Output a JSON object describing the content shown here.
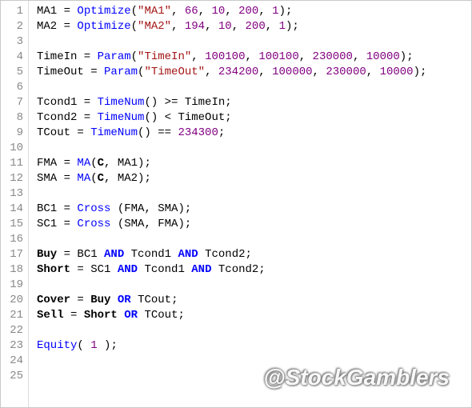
{
  "watermark": "@StockGamblers",
  "lines": [
    {
      "n": "1",
      "tokens": [
        {
          "t": "MA1 = "
        },
        {
          "t": "Optimize",
          "c": "fn"
        },
        {
          "t": "("
        },
        {
          "t": "\"MA1\"",
          "c": "str"
        },
        {
          "t": ", "
        },
        {
          "t": "66",
          "c": "num"
        },
        {
          "t": ", "
        },
        {
          "t": "10",
          "c": "num"
        },
        {
          "t": ", "
        },
        {
          "t": "200",
          "c": "num"
        },
        {
          "t": ", "
        },
        {
          "t": "1",
          "c": "num"
        },
        {
          "t": ");"
        }
      ]
    },
    {
      "n": "2",
      "tokens": [
        {
          "t": "MA2 = "
        },
        {
          "t": "Optimize",
          "c": "fn"
        },
        {
          "t": "("
        },
        {
          "t": "\"MA2\"",
          "c": "str"
        },
        {
          "t": ", "
        },
        {
          "t": "194",
          "c": "num"
        },
        {
          "t": ", "
        },
        {
          "t": "10",
          "c": "num"
        },
        {
          "t": ", "
        },
        {
          "t": "200",
          "c": "num"
        },
        {
          "t": ", "
        },
        {
          "t": "1",
          "c": "num"
        },
        {
          "t": ");"
        }
      ]
    },
    {
      "n": "3",
      "tokens": []
    },
    {
      "n": "4",
      "tokens": [
        {
          "t": "TimeIn = "
        },
        {
          "t": "Param",
          "c": "fn"
        },
        {
          "t": "("
        },
        {
          "t": "\"TimeIn\"",
          "c": "str"
        },
        {
          "t": ", "
        },
        {
          "t": "100100",
          "c": "num"
        },
        {
          "t": ", "
        },
        {
          "t": "100100",
          "c": "num"
        },
        {
          "t": ", "
        },
        {
          "t": "230000",
          "c": "num"
        },
        {
          "t": ", "
        },
        {
          "t": "10000",
          "c": "num"
        },
        {
          "t": ");"
        }
      ]
    },
    {
      "n": "5",
      "tokens": [
        {
          "t": "TimeOut = "
        },
        {
          "t": "Param",
          "c": "fn"
        },
        {
          "t": "("
        },
        {
          "t": "\"TimeOut\"",
          "c": "str"
        },
        {
          "t": ", "
        },
        {
          "t": "234200",
          "c": "num"
        },
        {
          "t": ", "
        },
        {
          "t": "100000",
          "c": "num"
        },
        {
          "t": ", "
        },
        {
          "t": "230000",
          "c": "num"
        },
        {
          "t": ", "
        },
        {
          "t": "10000",
          "c": "num"
        },
        {
          "t": ");"
        }
      ]
    },
    {
      "n": "6",
      "tokens": []
    },
    {
      "n": "7",
      "tokens": [
        {
          "t": "Tcond1 = "
        },
        {
          "t": "TimeNum",
          "c": "fn"
        },
        {
          "t": "() >= TimeIn;"
        }
      ]
    },
    {
      "n": "8",
      "tokens": [
        {
          "t": "Tcond2 = "
        },
        {
          "t": "TimeNum",
          "c": "fn"
        },
        {
          "t": "() < TimeOut;"
        }
      ]
    },
    {
      "n": "9",
      "tokens": [
        {
          "t": "TCout = "
        },
        {
          "t": "TimeNum",
          "c": "fn"
        },
        {
          "t": "() == "
        },
        {
          "t": "234300",
          "c": "num"
        },
        {
          "t": ";"
        }
      ]
    },
    {
      "n": "10",
      "tokens": []
    },
    {
      "n": "11",
      "tokens": [
        {
          "t": "FMA = "
        },
        {
          "t": "MA",
          "c": "fn"
        },
        {
          "t": "("
        },
        {
          "t": "C",
          "c": "bld"
        },
        {
          "t": ", MA1);"
        }
      ]
    },
    {
      "n": "12",
      "tokens": [
        {
          "t": "SMA = "
        },
        {
          "t": "MA",
          "c": "fn"
        },
        {
          "t": "("
        },
        {
          "t": "C",
          "c": "bld"
        },
        {
          "t": ", MA2);"
        }
      ]
    },
    {
      "n": "13",
      "tokens": []
    },
    {
      "n": "14",
      "tokens": [
        {
          "t": "BC1 = "
        },
        {
          "t": "Cross",
          "c": "fn"
        },
        {
          "t": " (FMA, SMA);"
        }
      ]
    },
    {
      "n": "15",
      "tokens": [
        {
          "t": "SC1 = "
        },
        {
          "t": "Cross",
          "c": "fn"
        },
        {
          "t": " (SMA, FMA);"
        }
      ]
    },
    {
      "n": "16",
      "tokens": []
    },
    {
      "n": "17",
      "tokens": [
        {
          "t": "Buy",
          "c": "bld"
        },
        {
          "t": " = BC1 "
        },
        {
          "t": "AND",
          "c": "kw"
        },
        {
          "t": " Tcond1 "
        },
        {
          "t": "AND",
          "c": "kw"
        },
        {
          "t": " Tcond2;"
        }
      ]
    },
    {
      "n": "18",
      "tokens": [
        {
          "t": "Short",
          "c": "bld"
        },
        {
          "t": " = SC1 "
        },
        {
          "t": "AND",
          "c": "kw"
        },
        {
          "t": " Tcond1 "
        },
        {
          "t": "AND",
          "c": "kw"
        },
        {
          "t": " Tcond2;"
        }
      ]
    },
    {
      "n": "19",
      "tokens": []
    },
    {
      "n": "20",
      "tokens": [
        {
          "t": "Cover",
          "c": "bld"
        },
        {
          "t": " = "
        },
        {
          "t": "Buy",
          "c": "bld"
        },
        {
          "t": " "
        },
        {
          "t": "OR",
          "c": "kw"
        },
        {
          "t": " TCout;"
        }
      ]
    },
    {
      "n": "21",
      "tokens": [
        {
          "t": "Sell",
          "c": "bld"
        },
        {
          "t": " = "
        },
        {
          "t": "Short",
          "c": "bld"
        },
        {
          "t": " "
        },
        {
          "t": "OR",
          "c": "kw"
        },
        {
          "t": " TCout;"
        }
      ]
    },
    {
      "n": "22",
      "tokens": []
    },
    {
      "n": "23",
      "tokens": [
        {
          "t": "Equity",
          "c": "fn"
        },
        {
          "t": "( "
        },
        {
          "t": "1",
          "c": "num"
        },
        {
          "t": " );"
        }
      ]
    },
    {
      "n": "24",
      "tokens": []
    },
    {
      "n": "25",
      "tokens": []
    }
  ]
}
